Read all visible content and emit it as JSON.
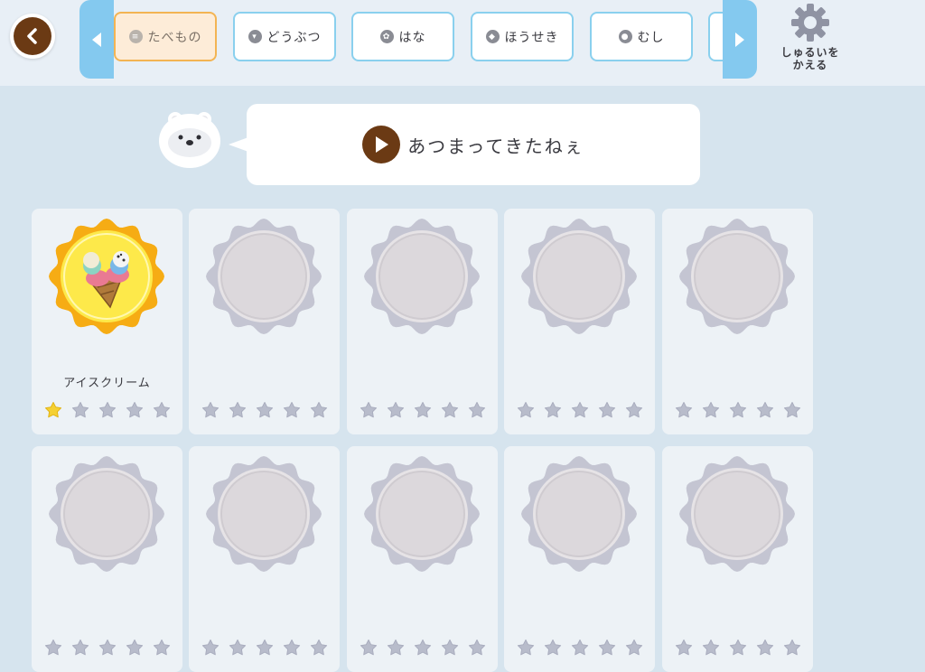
{
  "header": {
    "back_icon": "chevron-left-icon",
    "categories": [
      {
        "label": "たべもの",
        "icon": "food-icon",
        "active": true
      },
      {
        "label": "どうぶつ",
        "icon": "animal-icon",
        "active": false
      },
      {
        "label": "はな",
        "icon": "flower-icon",
        "active": false
      },
      {
        "label": "ほうせき",
        "icon": "gem-icon",
        "active": false
      },
      {
        "label": "むし",
        "icon": "bug-icon",
        "active": false
      }
    ],
    "settings_label_line1": "しゅるいを",
    "settings_label_line2": "かえる"
  },
  "speech": {
    "message": "あつまってきたねぇ"
  },
  "collection": {
    "items": [
      {
        "name": "アイスクリーム",
        "unlocked": true,
        "stars": 1
      },
      {
        "name": "",
        "unlocked": false,
        "stars": 0
      },
      {
        "name": "",
        "unlocked": false,
        "stars": 0
      },
      {
        "name": "",
        "unlocked": false,
        "stars": 0
      },
      {
        "name": "",
        "unlocked": false,
        "stars": 0
      },
      {
        "name": "",
        "unlocked": false,
        "stars": 0
      },
      {
        "name": "",
        "unlocked": false,
        "stars": 0
      },
      {
        "name": "",
        "unlocked": false,
        "stars": 0
      },
      {
        "name": "",
        "unlocked": false,
        "stars": 0
      },
      {
        "name": "",
        "unlocked": false,
        "stars": 0
      }
    ],
    "max_stars": 5
  },
  "colors": {
    "background": "#d6e4ee",
    "accent_brown": "#6b3a14",
    "arrow_blue": "#84c9ef",
    "active_tab_border": "#f3b453",
    "star_filled": "#f5d033",
    "star_empty": "#b8bccb",
    "badge_locked": "#c4c5d2"
  }
}
